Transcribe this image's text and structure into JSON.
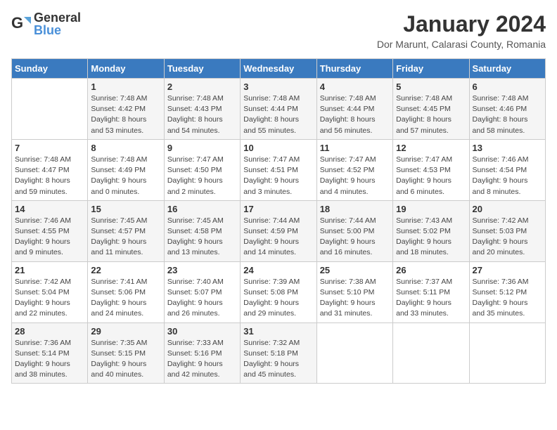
{
  "logo": {
    "general": "General",
    "blue": "Blue"
  },
  "title": "January 2024",
  "subtitle": "Dor Marunt, Calarasi County, Romania",
  "headers": [
    "Sunday",
    "Monday",
    "Tuesday",
    "Wednesday",
    "Thursday",
    "Friday",
    "Saturday"
  ],
  "weeks": [
    [
      {
        "day": "",
        "info": ""
      },
      {
        "day": "1",
        "info": "Sunrise: 7:48 AM\nSunset: 4:42 PM\nDaylight: 8 hours\nand 53 minutes."
      },
      {
        "day": "2",
        "info": "Sunrise: 7:48 AM\nSunset: 4:43 PM\nDaylight: 8 hours\nand 54 minutes."
      },
      {
        "day": "3",
        "info": "Sunrise: 7:48 AM\nSunset: 4:44 PM\nDaylight: 8 hours\nand 55 minutes."
      },
      {
        "day": "4",
        "info": "Sunrise: 7:48 AM\nSunset: 4:44 PM\nDaylight: 8 hours\nand 56 minutes."
      },
      {
        "day": "5",
        "info": "Sunrise: 7:48 AM\nSunset: 4:45 PM\nDaylight: 8 hours\nand 57 minutes."
      },
      {
        "day": "6",
        "info": "Sunrise: 7:48 AM\nSunset: 4:46 PM\nDaylight: 8 hours\nand 58 minutes."
      }
    ],
    [
      {
        "day": "7",
        "info": "Sunrise: 7:48 AM\nSunset: 4:47 PM\nDaylight: 8 hours\nand 59 minutes."
      },
      {
        "day": "8",
        "info": "Sunrise: 7:48 AM\nSunset: 4:49 PM\nDaylight: 9 hours\nand 0 minutes."
      },
      {
        "day": "9",
        "info": "Sunrise: 7:47 AM\nSunset: 4:50 PM\nDaylight: 9 hours\nand 2 minutes."
      },
      {
        "day": "10",
        "info": "Sunrise: 7:47 AM\nSunset: 4:51 PM\nDaylight: 9 hours\nand 3 minutes."
      },
      {
        "day": "11",
        "info": "Sunrise: 7:47 AM\nSunset: 4:52 PM\nDaylight: 9 hours\nand 4 minutes."
      },
      {
        "day": "12",
        "info": "Sunrise: 7:47 AM\nSunset: 4:53 PM\nDaylight: 9 hours\nand 6 minutes."
      },
      {
        "day": "13",
        "info": "Sunrise: 7:46 AM\nSunset: 4:54 PM\nDaylight: 9 hours\nand 8 minutes."
      }
    ],
    [
      {
        "day": "14",
        "info": "Sunrise: 7:46 AM\nSunset: 4:55 PM\nDaylight: 9 hours\nand 9 minutes."
      },
      {
        "day": "15",
        "info": "Sunrise: 7:45 AM\nSunset: 4:57 PM\nDaylight: 9 hours\nand 11 minutes."
      },
      {
        "day": "16",
        "info": "Sunrise: 7:45 AM\nSunset: 4:58 PM\nDaylight: 9 hours\nand 13 minutes."
      },
      {
        "day": "17",
        "info": "Sunrise: 7:44 AM\nSunset: 4:59 PM\nDaylight: 9 hours\nand 14 minutes."
      },
      {
        "day": "18",
        "info": "Sunrise: 7:44 AM\nSunset: 5:00 PM\nDaylight: 9 hours\nand 16 minutes."
      },
      {
        "day": "19",
        "info": "Sunrise: 7:43 AM\nSunset: 5:02 PM\nDaylight: 9 hours\nand 18 minutes."
      },
      {
        "day": "20",
        "info": "Sunrise: 7:42 AM\nSunset: 5:03 PM\nDaylight: 9 hours\nand 20 minutes."
      }
    ],
    [
      {
        "day": "21",
        "info": "Sunrise: 7:42 AM\nSunset: 5:04 PM\nDaylight: 9 hours\nand 22 minutes."
      },
      {
        "day": "22",
        "info": "Sunrise: 7:41 AM\nSunset: 5:06 PM\nDaylight: 9 hours\nand 24 minutes."
      },
      {
        "day": "23",
        "info": "Sunrise: 7:40 AM\nSunset: 5:07 PM\nDaylight: 9 hours\nand 26 minutes."
      },
      {
        "day": "24",
        "info": "Sunrise: 7:39 AM\nSunset: 5:08 PM\nDaylight: 9 hours\nand 29 minutes."
      },
      {
        "day": "25",
        "info": "Sunrise: 7:38 AM\nSunset: 5:10 PM\nDaylight: 9 hours\nand 31 minutes."
      },
      {
        "day": "26",
        "info": "Sunrise: 7:37 AM\nSunset: 5:11 PM\nDaylight: 9 hours\nand 33 minutes."
      },
      {
        "day": "27",
        "info": "Sunrise: 7:36 AM\nSunset: 5:12 PM\nDaylight: 9 hours\nand 35 minutes."
      }
    ],
    [
      {
        "day": "28",
        "info": "Sunrise: 7:36 AM\nSunset: 5:14 PM\nDaylight: 9 hours\nand 38 minutes."
      },
      {
        "day": "29",
        "info": "Sunrise: 7:35 AM\nSunset: 5:15 PM\nDaylight: 9 hours\nand 40 minutes."
      },
      {
        "day": "30",
        "info": "Sunrise: 7:33 AM\nSunset: 5:16 PM\nDaylight: 9 hours\nand 42 minutes."
      },
      {
        "day": "31",
        "info": "Sunrise: 7:32 AM\nSunset: 5:18 PM\nDaylight: 9 hours\nand 45 minutes."
      },
      {
        "day": "",
        "info": ""
      },
      {
        "day": "",
        "info": ""
      },
      {
        "day": "",
        "info": ""
      }
    ]
  ]
}
